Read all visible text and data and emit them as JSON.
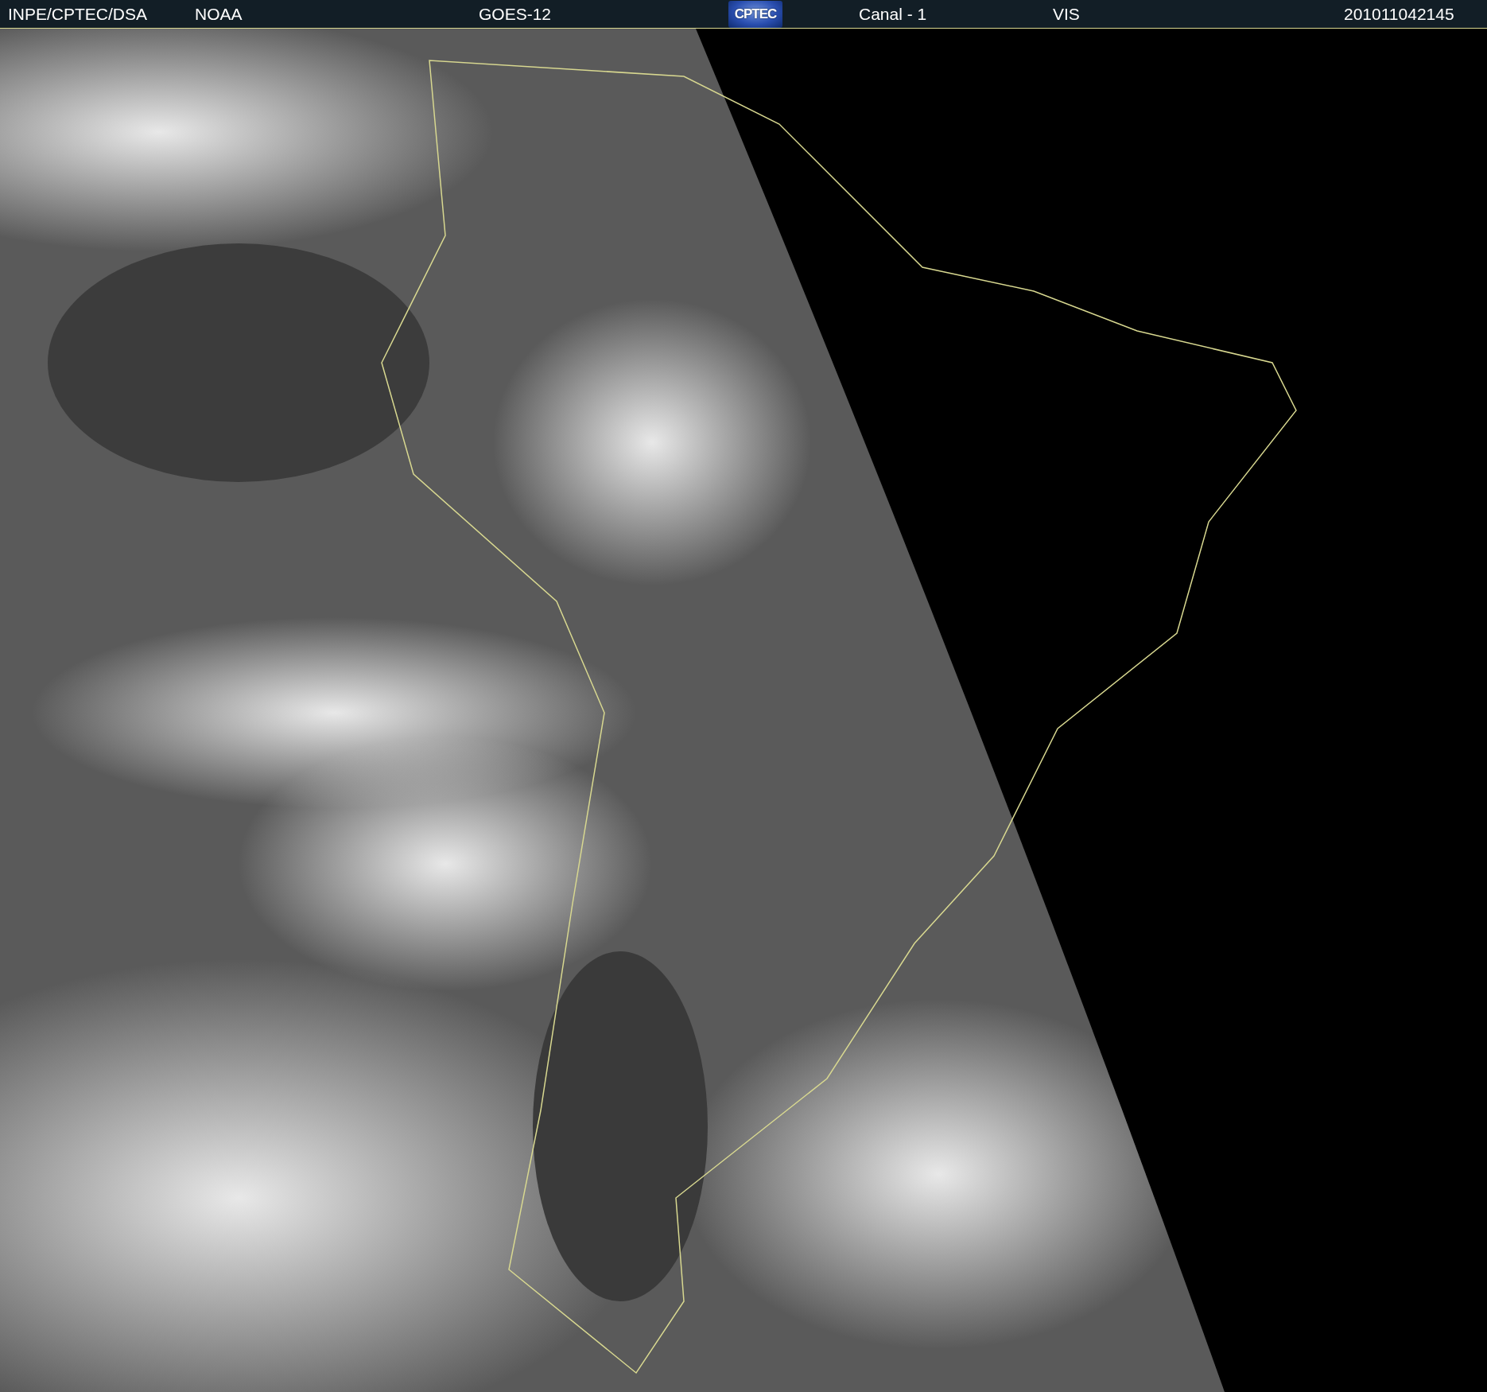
{
  "header": {
    "source": "INPE/CPTEC/DSA",
    "agency": "NOAA",
    "satellite": "GOES-12",
    "logo_text": "CPTEC",
    "channel": "Canal - 1",
    "band": "VIS",
    "timestamp": "201011042145"
  },
  "image": {
    "kind": "map-picture"
  }
}
